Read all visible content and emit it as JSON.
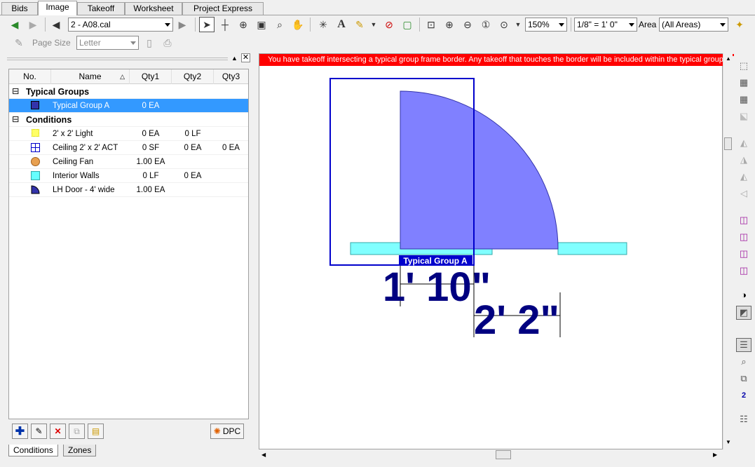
{
  "tabs": [
    {
      "label": "Bids"
    },
    {
      "label": "Image"
    },
    {
      "label": "Takeoff"
    },
    {
      "label": "Worksheet"
    },
    {
      "label": "Project Express"
    }
  ],
  "toolbar": {
    "page_select": "2 - A08.cal",
    "zoom": "150%",
    "scale": "1/8\" = 1' 0\"",
    "area_label": "Area",
    "area_select": "(All Areas)",
    "page_size_label": "Page Size",
    "page_size_select": "Letter"
  },
  "columns": {
    "no": "No.",
    "name": "Name",
    "qty1": "Qty1",
    "qty2": "Qty2",
    "qty3": "Qty3"
  },
  "groups": [
    {
      "title": "Typical Groups",
      "toggle": "⊟"
    },
    {
      "title": "Conditions",
      "toggle": "⊟"
    }
  ],
  "typical_groups": [
    {
      "name": "Typical Group A",
      "qty1": "0 EA",
      "qty2": "",
      "qty3": ""
    }
  ],
  "conditions": [
    {
      "name": "2' x 2' Light",
      "qty1": "0 EA",
      "qty2": "0 LF",
      "qty3": "",
      "color": "#ffff66"
    },
    {
      "name": "Ceiling 2' x 2' ACT",
      "qty1": "0 SF",
      "qty2": "0 EA",
      "qty3": "0 EA",
      "color": "#0000cc"
    },
    {
      "name": "Ceiling Fan",
      "qty1": "1.00 EA",
      "qty2": "",
      "qty3": "",
      "color": "#e8a050"
    },
    {
      "name": "Interior  Walls",
      "qty1": "0 LF",
      "qty2": "0 EA",
      "qty3": "",
      "color": "#66ffff"
    },
    {
      "name": "LH Door - 4' wide",
      "qty1": "1.00 EA",
      "qty2": "",
      "qty3": "",
      "color": "#3333aa"
    }
  ],
  "buttons": {
    "dpc": "DPC"
  },
  "bottom_tabs": [
    {
      "label": "Conditions"
    },
    {
      "label": "Zones"
    }
  ],
  "canvas": {
    "warning": "You have takeoff intersecting a typical group frame border.  Any takeoff that touches the border will be included within the typical group.",
    "group_label": "Typical Group A",
    "dim1": "1' 10\"",
    "dim2": "2' 2\""
  },
  "colors": {
    "door": "#8080ff",
    "wall": "#80ffff",
    "frame": "#0000cc",
    "dim": "#000080",
    "selection": "#3399ff",
    "warning": "#ff0000"
  }
}
